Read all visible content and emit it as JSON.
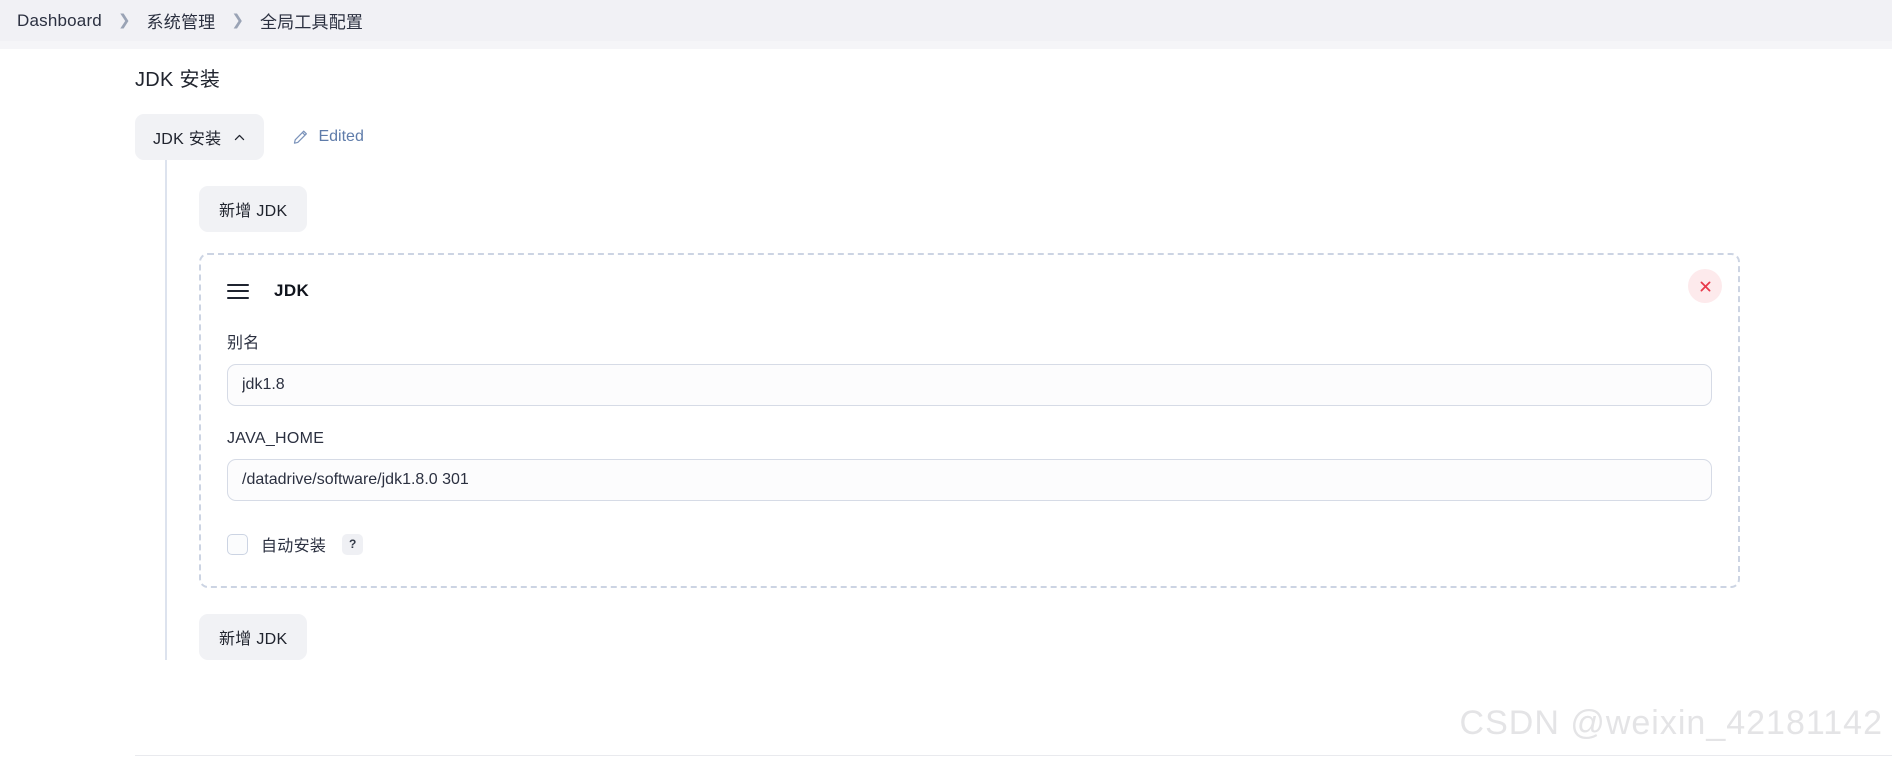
{
  "breadcrumb": {
    "items": [
      {
        "label": "Dashboard"
      },
      {
        "label": "系统管理"
      },
      {
        "label": "全局工具配置"
      }
    ],
    "separator": "❯"
  },
  "page": {
    "title": "JDK 安装"
  },
  "section": {
    "collapse_label": "JDK 安装",
    "collapse_icon": "chevron-up-icon",
    "edited_label": "Edited",
    "edited_icon": "pencil-icon",
    "edited_color": "#5f7caa"
  },
  "buttons": {
    "add_top": "新增 JDK",
    "add_bottom": "新增 JDK"
  },
  "jdk_card": {
    "drag_icon": "drag-handle-icon",
    "title": "JDK",
    "close_icon": "close-icon",
    "close_color": "#e8394a",
    "fields": [
      {
        "label": "别名",
        "value": "jdk1.8",
        "placeholder": ""
      },
      {
        "label": "JAVA_HOME",
        "value": "/datadrive/software/jdk1.8.0 301",
        "placeholder": ""
      }
    ],
    "checkbox": {
      "label": "自动安装",
      "checked": false,
      "help": "?"
    }
  },
  "watermark": "CSDN @weixin_42181142"
}
